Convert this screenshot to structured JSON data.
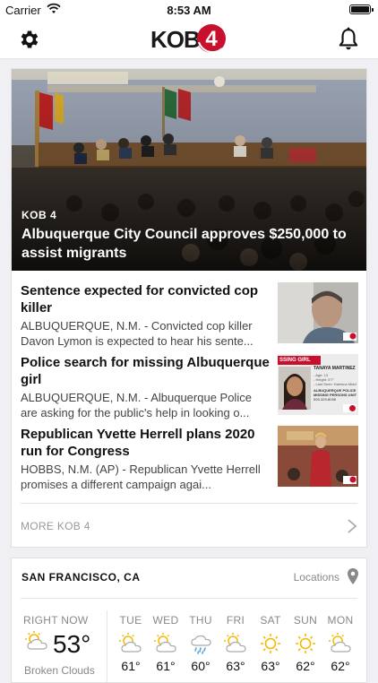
{
  "status_bar": {
    "carrier": "Carrier",
    "time": "8:53 AM"
  },
  "header": {
    "logo_text": "KOB",
    "logo_number": "4"
  },
  "hero": {
    "tag": "KOB 4",
    "title": "Albuquerque City Council approves $250,000 to assist migrants"
  },
  "stories": [
    {
      "title": "Sentence expected for convicted cop killer",
      "summary": "ALBUQUERQUE, N.M. - Convicted cop killer Davon Lymon is expected to hear his sente..."
    },
    {
      "title": "Police search for missing Albuquerque girl",
      "summary": "ALBUQUERQUE, N.M. - Albuquerque Police are asking for the public's help in looking o...",
      "thumb_banner": "SSING GIRL",
      "thumb_name": "TANAYA MARTINEZ",
      "thumb_lines": [
        "- Age: 13",
        "- Height: 5'7\"",
        "- Last Seen: Harrison Middle Scho",
        "ALBUQUERQUE POLICE DEPT",
        "MISSING PERSONS UNIT",
        "505-329-8098"
      ]
    },
    {
      "title": "Republican Yvette Herrell plans 2020 run for Congress",
      "summary": "HOBBS, N.M. (AP) - Republican Yvette Herrell promises a different campaign agai..."
    }
  ],
  "more_label": "MORE KOB 4",
  "weather": {
    "city": "SAN FRANCISCO, CA",
    "locations_label": "Locations",
    "now_label": "RIGHT NOW",
    "now_temp": "53°",
    "now_condition": "Broken Clouds",
    "days": [
      {
        "label": "TUE",
        "icon": "partly-cloudy-icon",
        "temp": "61°"
      },
      {
        "label": "WED",
        "icon": "partly-cloudy-icon",
        "temp": "61°"
      },
      {
        "label": "THU",
        "icon": "rain-icon",
        "temp": "60°"
      },
      {
        "label": "FRI",
        "icon": "partly-cloudy-icon",
        "temp": "63°"
      },
      {
        "label": "SAT",
        "icon": "sun-icon",
        "temp": "63°"
      },
      {
        "label": "SUN",
        "icon": "sun-icon",
        "temp": "62°"
      },
      {
        "label": "MON",
        "icon": "partly-cloudy-icon",
        "temp": "62°"
      }
    ]
  },
  "colors": {
    "brand_red": "#c8102e",
    "sun": "#f5b800"
  }
}
